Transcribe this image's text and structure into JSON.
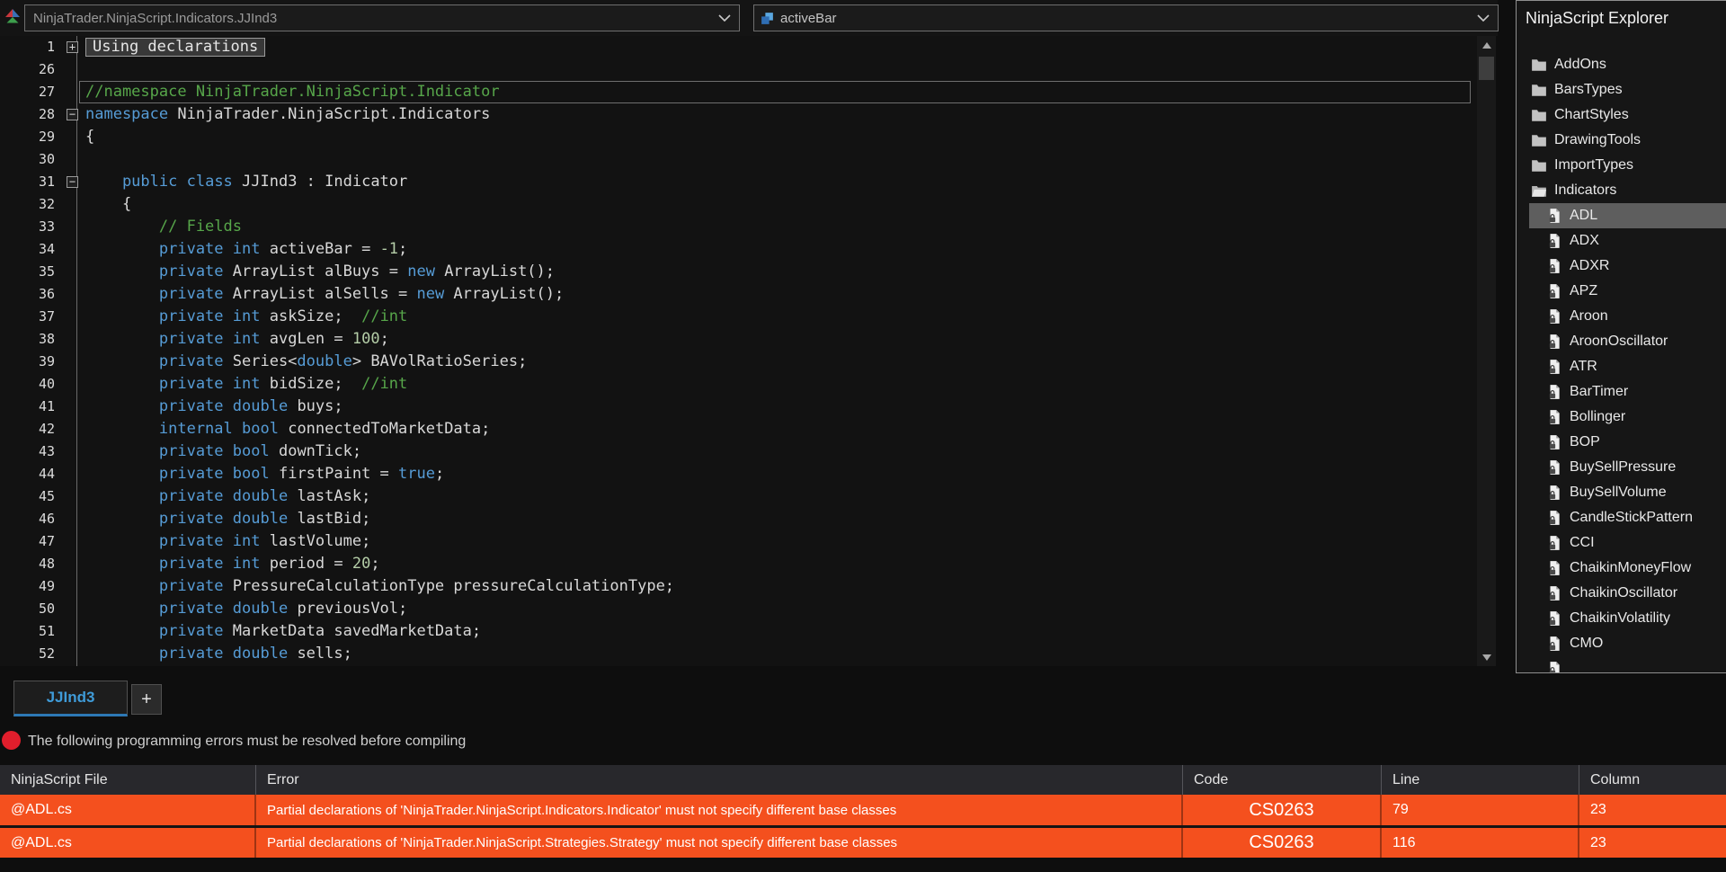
{
  "topbar": {
    "scope_selector": "NinjaTrader.NinjaScript.Indicators.JJInd3",
    "member_selector": "activeBar"
  },
  "explorer": {
    "title": "NinjaScript Explorer",
    "items": [
      {
        "type": "folder",
        "label": "AddOns"
      },
      {
        "type": "folder",
        "label": "BarsTypes"
      },
      {
        "type": "folder",
        "label": "ChartStyles"
      },
      {
        "type": "folder",
        "label": "DrawingTools"
      },
      {
        "type": "folder",
        "label": "ImportTypes"
      },
      {
        "type": "folder",
        "label": "Indicators",
        "open": true
      },
      {
        "type": "file",
        "label": "ADL",
        "selected": true
      },
      {
        "type": "file",
        "label": "ADX"
      },
      {
        "type": "file",
        "label": "ADXR"
      },
      {
        "type": "file",
        "label": "APZ"
      },
      {
        "type": "file",
        "label": "Aroon"
      },
      {
        "type": "file",
        "label": "AroonOscillator"
      },
      {
        "type": "file",
        "label": "ATR"
      },
      {
        "type": "file",
        "label": "BarTimer"
      },
      {
        "type": "file",
        "label": "Bollinger"
      },
      {
        "type": "file",
        "label": "BOP"
      },
      {
        "type": "file",
        "label": "BuySellPressure"
      },
      {
        "type": "file",
        "label": "BuySellVolume"
      },
      {
        "type": "file",
        "label": "CandleStickPattern"
      },
      {
        "type": "file",
        "label": "CCI"
      },
      {
        "type": "file",
        "label": "ChaikinMoneyFlow"
      },
      {
        "type": "file",
        "label": "ChaikinOscillator"
      },
      {
        "type": "file",
        "label": "ChaikinVolatility"
      },
      {
        "type": "file",
        "label": "CMO"
      },
      {
        "type": "file",
        "label": ""
      }
    ]
  },
  "editor": {
    "lines": [
      {
        "n": "1",
        "fold": "plus",
        "collapsed": "Using declarations"
      },
      {
        "n": "26"
      },
      {
        "n": "27",
        "outline": true,
        "t": [
          [
            "c",
            "//namespace NinjaTrader.NinjaScript.Indicator"
          ]
        ]
      },
      {
        "n": "28",
        "fold": "minus",
        "t": [
          [
            "k",
            "namespace"
          ],
          [
            "p",
            " NinjaTrader.NinjaScript.Indicators"
          ]
        ]
      },
      {
        "n": "29",
        "t": [
          [
            "p",
            "{"
          ]
        ]
      },
      {
        "n": "30"
      },
      {
        "n": "31",
        "fold": "minus",
        "i": 4,
        "t": [
          [
            "k",
            "public"
          ],
          [
            "p",
            " "
          ],
          [
            "k",
            "class"
          ],
          [
            "p",
            " JJInd3 : Indicator"
          ]
        ]
      },
      {
        "n": "32",
        "i": 4,
        "t": [
          [
            "p",
            "{"
          ]
        ]
      },
      {
        "n": "33",
        "i": 8,
        "t": [
          [
            "c",
            "// Fields"
          ]
        ]
      },
      {
        "n": "34",
        "i": 8,
        "t": [
          [
            "k",
            "private"
          ],
          [
            "p",
            " "
          ],
          [
            "k",
            "int"
          ],
          [
            "p",
            " activeBar = "
          ],
          [
            "n",
            "-1"
          ],
          [
            "p",
            ";"
          ]
        ]
      },
      {
        "n": "35",
        "i": 8,
        "t": [
          [
            "k",
            "private"
          ],
          [
            "p",
            " ArrayList alBuys = "
          ],
          [
            "k",
            "new"
          ],
          [
            "p",
            " ArrayList();"
          ]
        ]
      },
      {
        "n": "36",
        "i": 8,
        "t": [
          [
            "k",
            "private"
          ],
          [
            "p",
            " ArrayList alSells = "
          ],
          [
            "k",
            "new"
          ],
          [
            "p",
            " ArrayList();"
          ]
        ]
      },
      {
        "n": "37",
        "i": 8,
        "t": [
          [
            "k",
            "private"
          ],
          [
            "p",
            " "
          ],
          [
            "k",
            "int"
          ],
          [
            "p",
            " askSize;  "
          ],
          [
            "c",
            "//int"
          ]
        ]
      },
      {
        "n": "38",
        "i": 8,
        "t": [
          [
            "k",
            "private"
          ],
          [
            "p",
            " "
          ],
          [
            "k",
            "int"
          ],
          [
            "p",
            " avgLen = "
          ],
          [
            "n",
            "100"
          ],
          [
            "p",
            ";"
          ]
        ]
      },
      {
        "n": "39",
        "i": 8,
        "t": [
          [
            "k",
            "private"
          ],
          [
            "p",
            " Series<"
          ],
          [
            "k",
            "double"
          ],
          [
            "p",
            "> BAVolRatioSeries;"
          ]
        ]
      },
      {
        "n": "40",
        "i": 8,
        "t": [
          [
            "k",
            "private"
          ],
          [
            "p",
            " "
          ],
          [
            "k",
            "int"
          ],
          [
            "p",
            " bidSize;  "
          ],
          [
            "c",
            "//int"
          ]
        ]
      },
      {
        "n": "41",
        "i": 8,
        "t": [
          [
            "k",
            "private"
          ],
          [
            "p",
            " "
          ],
          [
            "k",
            "double"
          ],
          [
            "p",
            " buys;"
          ]
        ]
      },
      {
        "n": "42",
        "i": 8,
        "t": [
          [
            "k",
            "internal"
          ],
          [
            "p",
            " "
          ],
          [
            "k",
            "bool"
          ],
          [
            "p",
            " connectedToMarketData;"
          ]
        ]
      },
      {
        "n": "43",
        "i": 8,
        "t": [
          [
            "k",
            "private"
          ],
          [
            "p",
            " "
          ],
          [
            "k",
            "bool"
          ],
          [
            "p",
            " downTick;"
          ]
        ]
      },
      {
        "n": "44",
        "i": 8,
        "t": [
          [
            "k",
            "private"
          ],
          [
            "p",
            " "
          ],
          [
            "k",
            "bool"
          ],
          [
            "p",
            " firstPaint = "
          ],
          [
            "k",
            "true"
          ],
          [
            "p",
            ";"
          ]
        ]
      },
      {
        "n": "45",
        "i": 8,
        "t": [
          [
            "k",
            "private"
          ],
          [
            "p",
            " "
          ],
          [
            "k",
            "double"
          ],
          [
            "p",
            " lastAsk;"
          ]
        ]
      },
      {
        "n": "46",
        "i": 8,
        "t": [
          [
            "k",
            "private"
          ],
          [
            "p",
            " "
          ],
          [
            "k",
            "double"
          ],
          [
            "p",
            " lastBid;"
          ]
        ]
      },
      {
        "n": "47",
        "i": 8,
        "t": [
          [
            "k",
            "private"
          ],
          [
            "p",
            " "
          ],
          [
            "k",
            "int"
          ],
          [
            "p",
            " lastVolume;"
          ]
        ]
      },
      {
        "n": "48",
        "i": 8,
        "t": [
          [
            "k",
            "private"
          ],
          [
            "p",
            " "
          ],
          [
            "k",
            "int"
          ],
          [
            "p",
            " period = "
          ],
          [
            "n",
            "20"
          ],
          [
            "p",
            ";"
          ]
        ]
      },
      {
        "n": "49",
        "i": 8,
        "t": [
          [
            "k",
            "private"
          ],
          [
            "p",
            " PressureCalculationType pressureCalculationType;"
          ]
        ]
      },
      {
        "n": "50",
        "i": 8,
        "t": [
          [
            "k",
            "private"
          ],
          [
            "p",
            " "
          ],
          [
            "k",
            "double"
          ],
          [
            "p",
            " previousVol;"
          ]
        ]
      },
      {
        "n": "51",
        "i": 8,
        "t": [
          [
            "k",
            "private"
          ],
          [
            "p",
            " MarketData savedMarketData;"
          ]
        ]
      },
      {
        "n": "52",
        "i": 8,
        "t": [
          [
            "k",
            "private"
          ],
          [
            "p",
            " "
          ],
          [
            "k",
            "double"
          ],
          [
            "p",
            " sells;"
          ]
        ]
      }
    ]
  },
  "tabs": {
    "active_label": "JJInd3",
    "new_tab_label": "+"
  },
  "status": {
    "message": "The following programming errors must be resolved before compiling"
  },
  "errors": {
    "columns": [
      "NinjaScript File",
      "Error",
      "Code",
      "Line",
      "Column"
    ],
    "rows": [
      {
        "file": "@ADL.cs",
        "error": "Partial declarations of 'NinjaTrader.NinjaScript.Indicators.Indicator' must not specify different base classes",
        "code": "CS0263",
        "line": "79",
        "column": "23"
      },
      {
        "file": "@ADL.cs",
        "error": "Partial declarations of 'NinjaTrader.NinjaScript.Strategies.Strategy' must not specify different base classes",
        "code": "CS0263",
        "line": "116",
        "column": "23"
      }
    ]
  }
}
